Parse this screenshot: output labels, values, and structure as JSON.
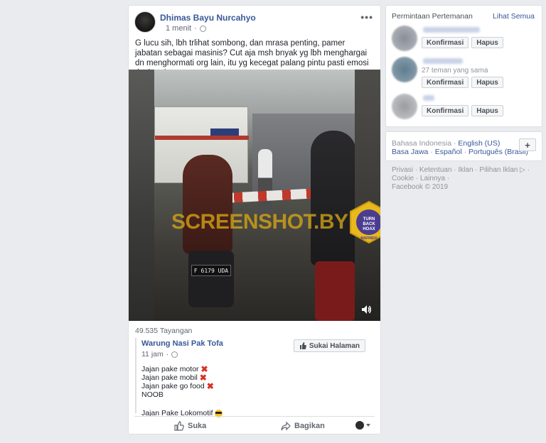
{
  "post": {
    "author": "Dhimas Bayu Nurcahyo",
    "time": "1 menit",
    "text": "G lucu sih, lbh trlihat sombong, dan mrasa penting, pamer jabatan sebagai masinis? Cut aja msh bnyak yg lbh menghargai dn menghormati org lain, itu yg kecegat palang pintu pasti emosi tingkat dewa",
    "video": {
      "watermark": "SCREENSHOT.BY",
      "plate": "F 6179 UDA",
      "badge_text": "TURN BACK HOAX",
      "badge_sub": "MAFINDO"
    },
    "views": "49.535 Tayangan",
    "shared": {
      "page_name": "Warung Nasi Pak Tofa",
      "time": "11 jam",
      "like_page_label": "Sukai Halaman",
      "lines": [
        "Jajan pake motor",
        "Jajan pake mobil",
        "Jajan pake go food",
        "NOOB"
      ],
      "last_line": "Jajan Pake Lokomotif"
    },
    "actions": {
      "like": "Suka",
      "share": "Bagikan"
    }
  },
  "requests": {
    "title": "Permintaan Pertemanan",
    "see_all": "Lihat Semua",
    "items": [
      {
        "mutual": "",
        "confirm": "Konfirmasi",
        "delete": "Hapus",
        "color": "#8a8f98"
      },
      {
        "mutual": "27 teman yang sama",
        "confirm": "Konfirmasi",
        "delete": "Hapus",
        "color": "#5f7d8f"
      },
      {
        "mutual": "",
        "confirm": "Konfirmasi",
        "delete": "Hapus",
        "color": "#9a9ca0"
      }
    ]
  },
  "languages": {
    "current": "Bahasa Indonesia",
    "row1": [
      "English (US)"
    ],
    "row2": [
      "Basa Jawa",
      "Español",
      "Português (Brasil)"
    ],
    "add": "+"
  },
  "footer": {
    "row1": [
      "Privasi",
      "Ketentuan",
      "Iklan",
      "Pilihan Iklan"
    ],
    "row2": [
      "Cookie",
      "Lainnya"
    ],
    "copyright": "Facebook © 2019"
  },
  "colors": {
    "link": "#385898",
    "background": "#e9ebee",
    "watermark": "#dcaa14"
  }
}
